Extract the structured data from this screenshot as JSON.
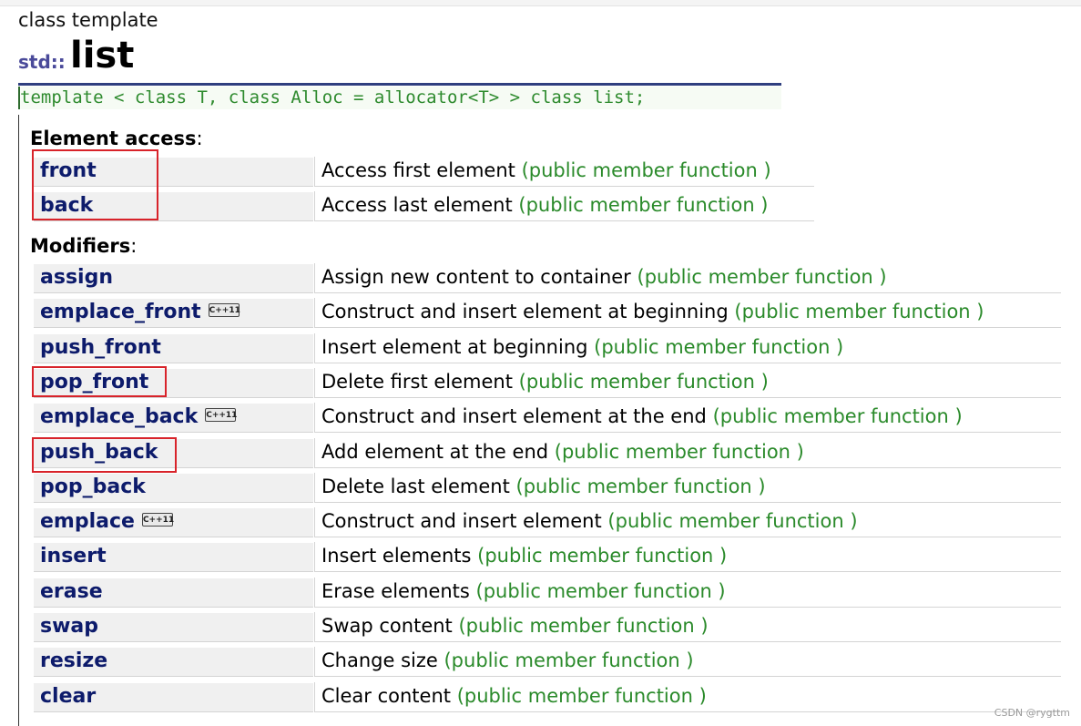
{
  "header": {
    "kind": "class template",
    "namespace": "std::",
    "name": "list",
    "prototype": "template < class T, class Alloc = allocator<T> > class list;"
  },
  "element_access": {
    "title": "Element access",
    "rows": [
      {
        "name": "front",
        "desc": "Access first element",
        "type": "(public member function )"
      },
      {
        "name": "back",
        "desc": "Access last element",
        "type": "(public member function )"
      }
    ]
  },
  "modifiers": {
    "title": "Modifiers",
    "rows": [
      {
        "name": "assign",
        "desc": "Assign new content to container",
        "type": "(public member function )"
      },
      {
        "name": "emplace_front",
        "badge": "C++11",
        "desc": "Construct and insert element at beginning",
        "type": "(public member function )"
      },
      {
        "name": "push_front",
        "desc": "Insert element at beginning",
        "type": "(public member function )"
      },
      {
        "name": "pop_front",
        "desc": "Delete first element",
        "type": "(public member function )"
      },
      {
        "name": "emplace_back",
        "badge": "C++11",
        "desc": "Construct and insert element at the end",
        "type": "(public member function )"
      },
      {
        "name": "push_back",
        "desc": "Add element at the end",
        "type": "(public member function )"
      },
      {
        "name": "pop_back",
        "desc": "Delete last element",
        "type": "(public member function )"
      },
      {
        "name": "emplace",
        "badge": "C++11",
        "desc": "Construct and insert element",
        "type": "(public member function )"
      },
      {
        "name": "insert",
        "desc": "Insert elements",
        "type": "(public member function )"
      },
      {
        "name": "erase",
        "desc": "Erase elements",
        "type": "(public member function )"
      },
      {
        "name": "swap",
        "desc": "Swap content",
        "type": "(public member function )"
      },
      {
        "name": "resize",
        "desc": "Change size",
        "type": "(public member function )"
      },
      {
        "name": "clear",
        "desc": "Clear content",
        "type": "(public member function )"
      }
    ]
  },
  "colors": {
    "member_name": "#0d1b6b",
    "member_type": "#2a8a2a",
    "highlight": "#d8232a"
  },
  "watermark": "CSDN @rygttm"
}
